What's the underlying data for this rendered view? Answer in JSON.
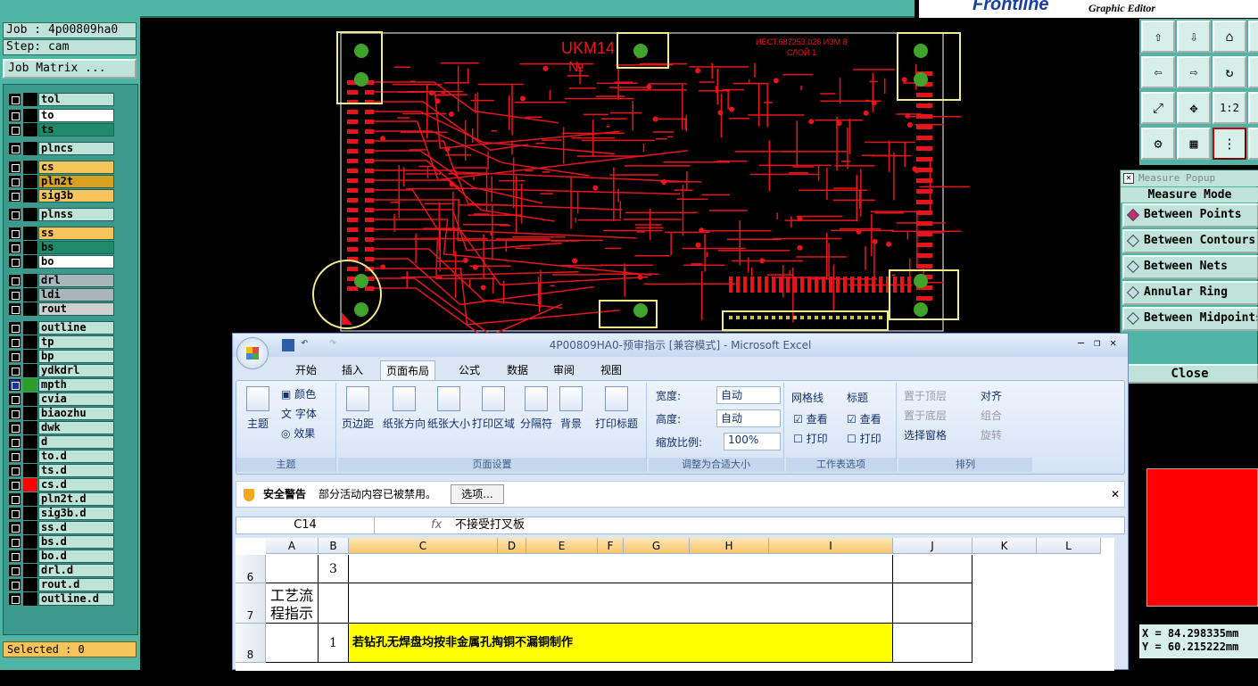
{
  "left_panel": {
    "job": "Job : 4p00809ha0",
    "step": "Step: cam",
    "job_matrix": "Job Matrix ...",
    "selected": "Selected : 0",
    "layers": [
      {
        "name": "tol",
        "color": "#bfe3d9"
      },
      {
        "name": "to",
        "color": "#ffffff"
      },
      {
        "name": "ts",
        "color": "#1e8a6a"
      },
      {
        "name": "plncs",
        "color": "#bfe3d9"
      },
      {
        "name": "cs",
        "color": "#f6c45a"
      },
      {
        "name": "pln2t",
        "color": "#d8a020"
      },
      {
        "name": "sig3b",
        "color": "#f6c45a"
      },
      {
        "name": "plnss",
        "color": "#bfe3d9"
      },
      {
        "name": "ss",
        "color": "#f6c45a"
      },
      {
        "name": "bs",
        "color": "#1e8a6a"
      },
      {
        "name": "bo",
        "color": "#ffffff"
      },
      {
        "name": "drl",
        "color": "#a9b7bd"
      },
      {
        "name": "ldi",
        "color": "#a9b7bd"
      },
      {
        "name": "rout",
        "color": "#d0d0d0"
      },
      {
        "name": "outline",
        "color": "#bfe3d9"
      },
      {
        "name": "tp",
        "color": "#bfe3d9"
      },
      {
        "name": "bp",
        "color": "#bfe3d9"
      },
      {
        "name": "ydkdrl",
        "color": "#bfe3d9"
      },
      {
        "name": "mpth",
        "color": "#bfe3d9"
      },
      {
        "name": "cvia",
        "color": "#bfe3d9"
      },
      {
        "name": "biaozhu",
        "color": "#bfe3d9"
      },
      {
        "name": "dwk",
        "color": "#bfe3d9"
      },
      {
        "name": "d",
        "color": "#bfe3d9"
      },
      {
        "name": "to.d",
        "color": "#bfe3d9"
      },
      {
        "name": "ts.d",
        "color": "#bfe3d9"
      },
      {
        "name": "cs.d",
        "color": "#bfe3d9"
      },
      {
        "name": "pln2t.d",
        "color": "#bfe3d9"
      },
      {
        "name": "sig3b.d",
        "color": "#bfe3d9"
      },
      {
        "name": "ss.d",
        "color": "#bfe3d9"
      },
      {
        "name": "bs.d",
        "color": "#bfe3d9"
      },
      {
        "name": "bo.d",
        "color": "#bfe3d9"
      },
      {
        "name": "drl.d",
        "color": "#bfe3d9"
      },
      {
        "name": "rout.d",
        "color": "#bfe3d9"
      },
      {
        "name": "outline.d",
        "color": "#bfe3d9"
      }
    ]
  },
  "logo": {
    "brand": "Frontline",
    "subtitle": "Graphic Editor"
  },
  "pcb": {
    "board_label": "UKM14",
    "number_label": "№",
    "doc_code": "ИЕСТ.687253.026 ИЗМ 8",
    "layer_label": "СЛОЙ 1",
    "trace_color": "#e8141c",
    "pad_color": "#3fa32c",
    "highlight_color": "#f2ec8a"
  },
  "measure": {
    "title": "Measure Popup",
    "mode_label": "Measure Mode",
    "options": [
      "Between Points",
      "Between Contours",
      "Between Nets",
      "Annular Ring",
      "Between Midpoints"
    ],
    "selected": "Between Points",
    "close": "Close",
    "x": "X = 84.298335mm",
    "y": "Y = 60.215222mm"
  },
  "excel": {
    "title": "4P00809HA0-预审指示 [兼容模式] - Microsoft Excel",
    "tabs": [
      "开始",
      "插入",
      "页面布局",
      "公式",
      "数据",
      "审阅",
      "视图"
    ],
    "active_tab": "页面布局",
    "groups": {
      "theme": {
        "label": "主题",
        "items": [
          "主题",
          "颜色",
          "字体",
          "效果"
        ]
      },
      "page_setup": {
        "label": "页面设置",
        "items": [
          "页边距",
          "纸张方向",
          "纸张大小",
          "打印区域",
          "分隔符",
          "背景",
          "打印标题"
        ]
      },
      "scale": {
        "label": "调整为合适大小",
        "width_label": "宽度:",
        "width_val": "自动",
        "height_label": "高度:",
        "height_val": "自动",
        "zoom_label": "缩放比例:",
        "zoom_val": "100%"
      },
      "sheet": {
        "label": "工作表选项",
        "gridlines": "网格线",
        "headings": "标题",
        "view": "查看",
        "print": "打印"
      },
      "arrange": {
        "label": "排列",
        "items": [
          "置于顶层",
          "置于底层",
          "选择窗格",
          "对齐",
          "组合",
          "旋转"
        ]
      }
    },
    "warning": {
      "title": "安全警告",
      "message": "部分活动内容已被禁用。",
      "button": "选项..."
    },
    "name_box": "C14",
    "formula": "不接受打叉板",
    "columns": [
      "A",
      "B",
      "C",
      "D",
      "E",
      "F",
      "G",
      "H",
      "I",
      "J",
      "K",
      "L"
    ],
    "rows": [
      {
        "num": "6",
        "b": "3",
        "a": ""
      },
      {
        "num": "7",
        "a": "工艺流程指示",
        "b": ""
      },
      {
        "num": "8",
        "b": "1",
        "c": "若钻孔无焊盘均按非金属孔掏铜不漏铜制作"
      }
    ]
  }
}
